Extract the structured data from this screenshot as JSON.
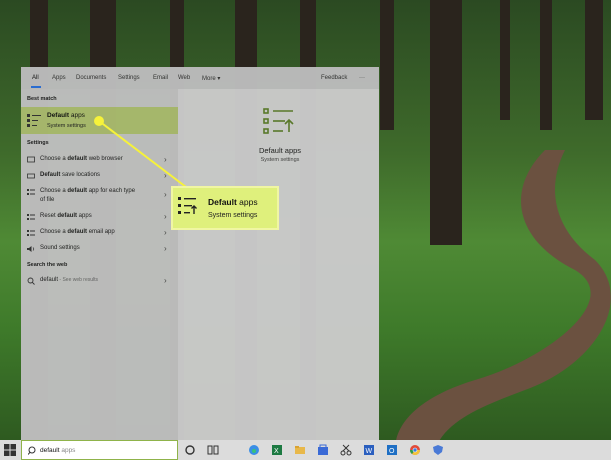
{
  "tabs": [
    "All",
    "Apps",
    "Documents",
    "Settings",
    "Email",
    "Web",
    "More ▾"
  ],
  "feedback": "Feedback",
  "overflow": "···",
  "sections": {
    "best": "Best match",
    "settings": "Settings",
    "web": "Search the web"
  },
  "best_match": {
    "title_bold": "Default",
    "title_rest": " apps",
    "subtitle": "System settings"
  },
  "settings_items": [
    {
      "pre": "Choose a ",
      "bold": "default",
      "post": " web browser"
    },
    {
      "pre": "",
      "bold": "Default",
      "post": " save locations"
    },
    {
      "pre": "Choose a ",
      "bold": "default",
      "post": " app for each type"
    },
    {
      "pre": "of file",
      "bold": "",
      "post": ""
    },
    {
      "pre": "Reset ",
      "bold": "default",
      "post": " apps"
    },
    {
      "pre": "Choose a ",
      "bold": "default",
      "post": " email app"
    },
    {
      "pre": "Sound settings",
      "bold": "",
      "post": ""
    }
  ],
  "web_item": {
    "query": "default",
    "hint": " - See web results"
  },
  "right_panel": {
    "title": "Default apps",
    "subtitle": "System settings"
  },
  "callout": {
    "title_bold": "Default",
    "title_rest": " apps",
    "subtitle": "System settings"
  },
  "searchbox": {
    "typed": "default",
    "ghost": " apps"
  },
  "colors": {
    "highlight": "#a9ba6e",
    "callout": "#dff07c",
    "accent": "#2a6fd6"
  }
}
